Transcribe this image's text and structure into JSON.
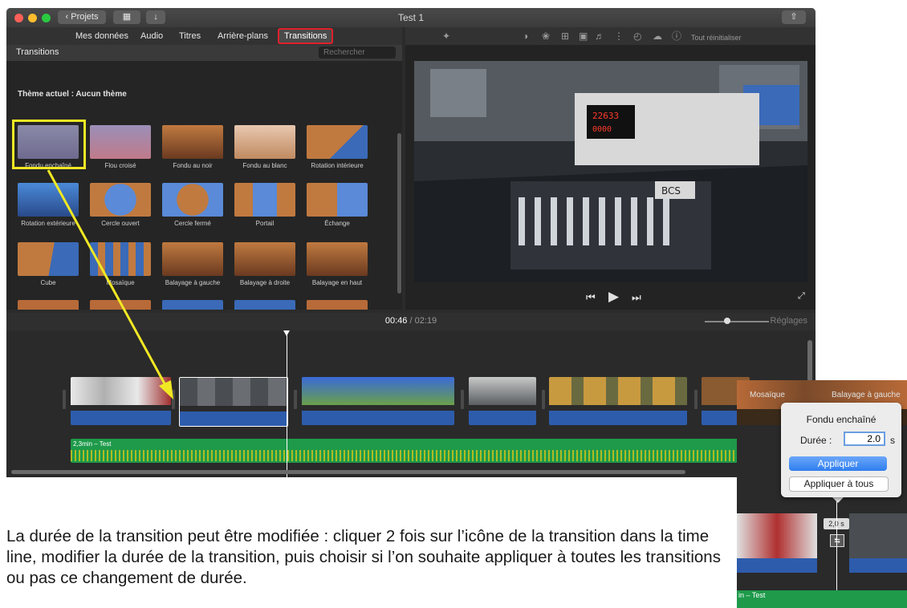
{
  "window": {
    "title": "Test 1",
    "projects_button": "Projets"
  },
  "tabs": [
    {
      "label": "Mes données",
      "selected": false
    },
    {
      "label": "Audio",
      "selected": false
    },
    {
      "label": "Titres",
      "selected": false
    },
    {
      "label": "Arrière-plans",
      "selected": false
    },
    {
      "label": "Transitions",
      "selected": true
    }
  ],
  "tools": {
    "reset_label": "Tout réinitialiser"
  },
  "browser": {
    "title": "Transitions",
    "search_placeholder": "Rechercher",
    "theme_label": "Thème actuel : Aucun thème",
    "items": [
      {
        "label": "Fondu enchaîné",
        "selected": true
      },
      {
        "label": "Flou croisé"
      },
      {
        "label": "Fondu au noir"
      },
      {
        "label": "Fondu au blanc"
      },
      {
        "label": "Rotation intérieure"
      },
      {
        "label": "Rotation extérieure"
      },
      {
        "label": "Cercle ouvert"
      },
      {
        "label": "Cercle fermé"
      },
      {
        "label": "Portail"
      },
      {
        "label": "Échange"
      },
      {
        "label": "Cube"
      },
      {
        "label": "Mosaïque"
      },
      {
        "label": "Balayage à gauche"
      },
      {
        "label": "Balayage à droite"
      },
      {
        "label": "Balayage en haut"
      }
    ]
  },
  "viewer": {
    "display_top": "22633",
    "display_bottom": "0000",
    "panel_brand": "BCS"
  },
  "timeline": {
    "current": "00:46",
    "separator": "/",
    "total": "02:19",
    "settings_label": "Réglages",
    "audio_label": "2,3min – Test"
  },
  "inset": {
    "top_labels": [
      "Mosaïque",
      "Balayage à gauche"
    ],
    "popover_title": "Fondu enchaîné",
    "duration_label": "Durée :",
    "duration_value": "2.0",
    "duration_unit": "s",
    "apply_label": "Appliquer",
    "apply_all_label": "Appliquer à tous",
    "badge": "2,0 s",
    "audio_label": "in – Test"
  },
  "caption": "La durée de la transition peut être modifiée : cliquer 2 fois sur l’icône de la transition dans la time line, modifier la durée de la transition, puis choisir si l’on souhaite appliquer à toutes les transitions ou pas ce changement de durée."
}
